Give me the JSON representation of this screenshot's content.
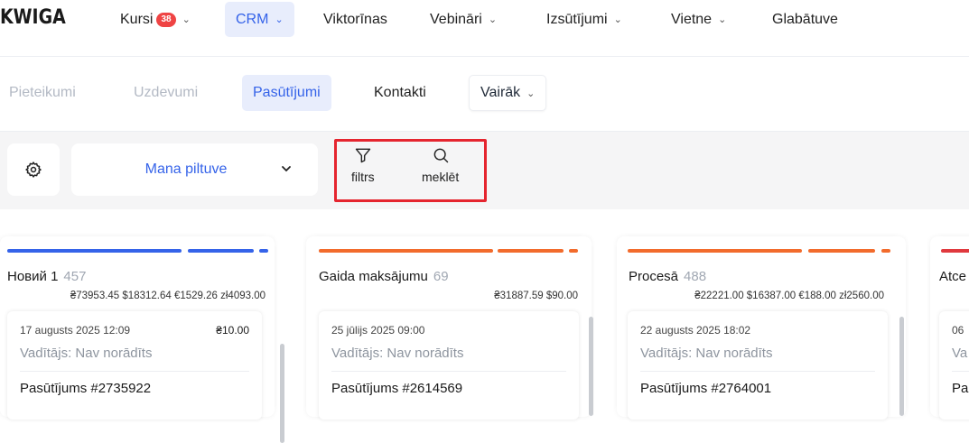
{
  "topnav": {
    "logo": "KWIGA",
    "items": [
      {
        "label": "Kursi",
        "badge": "38",
        "has_dropdown": true
      },
      {
        "label": "CRM",
        "has_dropdown": true,
        "active": true
      },
      {
        "label": "Viktorīnas"
      },
      {
        "label": "Vebināri",
        "has_dropdown": true
      },
      {
        "label": "Izsūtījumi",
        "has_dropdown": true
      },
      {
        "label": "Vietne",
        "has_dropdown": true
      },
      {
        "label": "Glabātuve"
      }
    ]
  },
  "subnav": {
    "items": [
      {
        "label": "Pieteikumi"
      },
      {
        "label": "Uzdevumi"
      },
      {
        "label": "Pasūtījumi",
        "active": true
      },
      {
        "label": "Kontakti"
      },
      {
        "label": "Vairāk",
        "has_dropdown": true
      }
    ]
  },
  "toolbar": {
    "settings_icon": "gear-icon",
    "funnel": "Mana piltuve",
    "filter_label": "filtrs",
    "search_label": "meklēt",
    "highlight_color": "#e5252f"
  },
  "columns": [
    {
      "title": "Новий 1",
      "count": "457",
      "sums": "₴73953.45 $18312.64 €1529.26 zł4093.00",
      "color": "#3563e9",
      "card": {
        "date": "17 augusts 2025 12:09",
        "amount": "₴10.00",
        "manager": "Vadītājs: Nav norādīts",
        "order": "Pasūtījums #2735922"
      }
    },
    {
      "title": "Gaida maksājumu",
      "count": "69",
      "sums": "₴31887.59 $90.00",
      "color": "#f26b2c",
      "card": {
        "date": "25 jūlijs 2025 09:00",
        "amount": "",
        "manager": "Vadītājs: Nav norādīts",
        "order": "Pasūtījums #2614569"
      }
    },
    {
      "title": "Procesā",
      "count": "488",
      "sums": "₴22221.00 $16387.00 €188.00 zł2560.00",
      "color": "#f26b2c",
      "card": {
        "date": "22 augusts 2025 18:02",
        "amount": "",
        "manager": "Vadītājs: Nav norādīts",
        "order": "Pasūtījums #2764001"
      }
    },
    {
      "title": "Atce",
      "count": "",
      "sums": "",
      "color": "#e0393e",
      "card": {
        "date": "06 ",
        "amount": "",
        "manager": "Va",
        "order": "Pa"
      }
    }
  ]
}
